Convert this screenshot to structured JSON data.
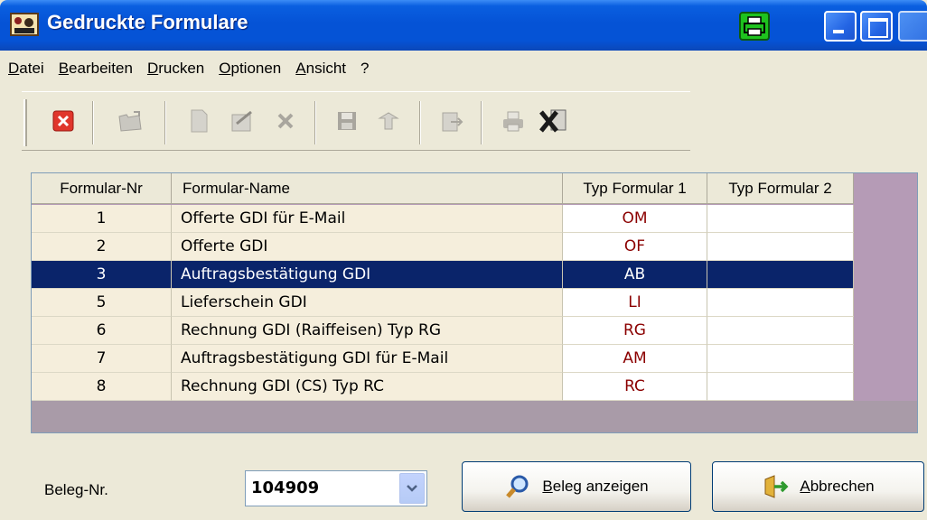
{
  "window": {
    "title": "Gedruckte Formulare"
  },
  "menu": {
    "items": [
      {
        "first": "D",
        "rest": "atei"
      },
      {
        "first": "B",
        "rest": "earbeiten"
      },
      {
        "first": "D",
        "rest": "rucken"
      },
      {
        "first": "O",
        "rest": "ptionen"
      },
      {
        "first": "A",
        "rest": "nsicht"
      },
      {
        "first": "?",
        "rest": ""
      }
    ]
  },
  "table": {
    "columns": [
      "Formular-Nr",
      "Formular-Name",
      "Typ Formular 1",
      "Typ Formular 2"
    ],
    "rows": [
      {
        "nr": "1",
        "name": "Offerte GDI für E-Mail",
        "typ1": "OM",
        "typ2": ""
      },
      {
        "nr": "2",
        "name": "Offerte GDI",
        "typ1": "OF",
        "typ2": ""
      },
      {
        "nr": "3",
        "name": "Auftragsbestätigung GDI",
        "typ1": "AB",
        "typ2": ""
      },
      {
        "nr": "5",
        "name": "Lieferschein GDI",
        "typ1": "LI",
        "typ2": ""
      },
      {
        "nr": "6",
        "name": "Rechnung GDI (Raiffeisen) Typ RG",
        "typ1": "RG",
        "typ2": ""
      },
      {
        "nr": "7",
        "name": "Auftragsbestätigung GDI für E-Mail",
        "typ1": "AM",
        "typ2": ""
      },
      {
        "nr": "8",
        "name": "Rechnung GDI (CS) Typ RC",
        "typ1": "RC",
        "typ2": ""
      }
    ],
    "selected_index": 2
  },
  "footer": {
    "beleg_label": "Beleg-Nr.",
    "beleg_value": "104909",
    "show_button": {
      "first": "B",
      "rest": "eleg anzeigen"
    },
    "cancel_button": {
      "first": "A",
      "rest": "bbrechen"
    }
  },
  "colors": {
    "titlebar": "#0553D6",
    "selection": "#0A246A",
    "type_text": "#8B0000",
    "grid_background": "#B59BB6"
  },
  "icons": {
    "toolbar": [
      "close-red-icon",
      "open-folder-icon",
      "new-document-icon",
      "edit-document-icon",
      "delete-x-icon",
      "save-disk-icon",
      "undo-icon",
      "export-icon",
      "print-icon",
      "excel-icon"
    ]
  }
}
